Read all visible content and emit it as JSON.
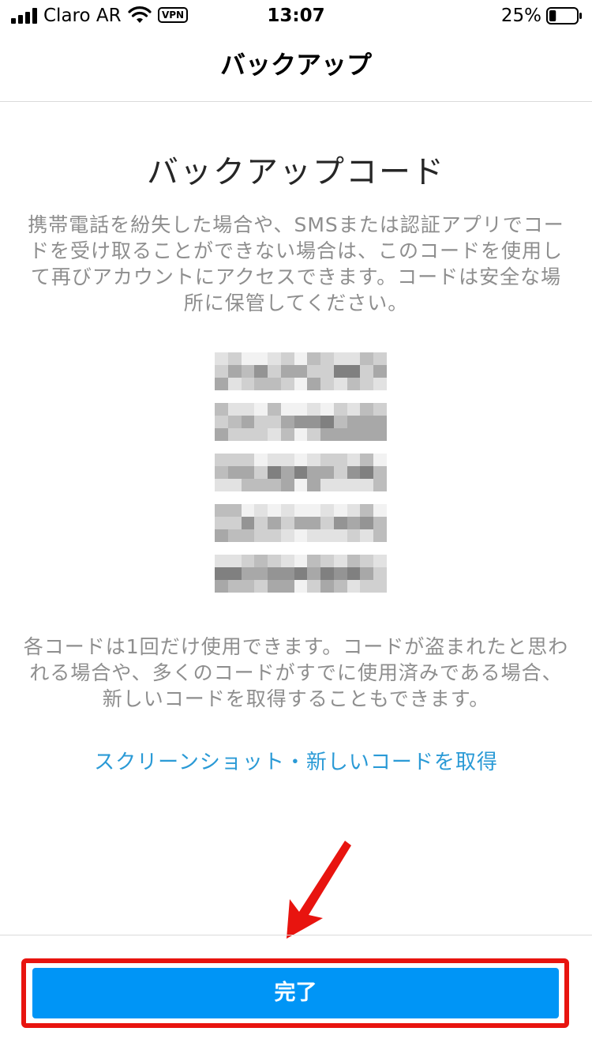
{
  "status_bar": {
    "carrier": "Claro AR",
    "vpn": "VPN",
    "time": "13:07",
    "battery": "25%",
    "battery_level": 0.25,
    "icons": [
      "signal-icon",
      "wifi-icon",
      "battery-icon"
    ]
  },
  "nav": {
    "title": "バックアップ"
  },
  "content": {
    "heading": "バックアップコード",
    "description": "携帯電話を紛失した場合や、SMSまたは認証アプリでコードを受け取ることができない場合は、このコードを使用して再びアカウントにアクセスできます。コードは安全な場所に保管してください。",
    "note": "各コードは1回だけ使用できます。コードが盗まれたと思われる場合や、多くのコードがすでに使用済みである場合、新しいコードを取得することもできます。",
    "link_screenshot": "スクリーンショット",
    "link_separator": "・",
    "link_new_codes": "新しいコードを取得"
  },
  "footer": {
    "done_label": "完了"
  },
  "colors": {
    "accent": "#0095f6",
    "link": "#2a9ad6",
    "highlight": "#e8140f",
    "muted_text": "#8e8e8e"
  }
}
